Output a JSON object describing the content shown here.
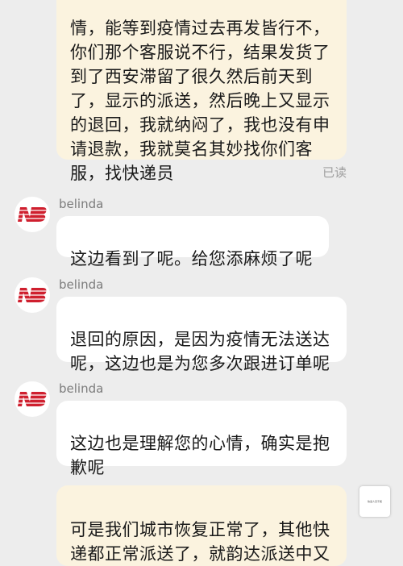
{
  "messages": {
    "user1": {
      "text": "情，能等到疫情过去再发皆行不，\n你们那个客服说不行，结果发货了\n到了西安滞留了很久然后前天到\n了，显示的派送，然后晚上又显示\n的退回，我就纳闷了，我也没有申\n请退款，我就莫名其妙找你们客\n服，找快递员",
      "status": "已读"
    },
    "agent1": {
      "sender": "belinda",
      "text": "这边看到了呢。给您添麻烦了呢"
    },
    "agent2": {
      "sender": "belinda",
      "text": "退回的原因，是因为疫情无法送达\n呢，这边也是为您多次跟进订单呢"
    },
    "agent3": {
      "sender": "belinda",
      "text": "这边也是理解您的心情，确实是抱\n歉呢"
    },
    "user2": {
      "text": "可是我们城市恢复正常了，其他快\n递都正常派送了，就韵达派送中又"
    }
  },
  "avatar": {
    "logo": "new-balance-logo",
    "color": "#cf1f2e"
  },
  "thumbnail": {
    "caption": "快递人员不能"
  }
}
